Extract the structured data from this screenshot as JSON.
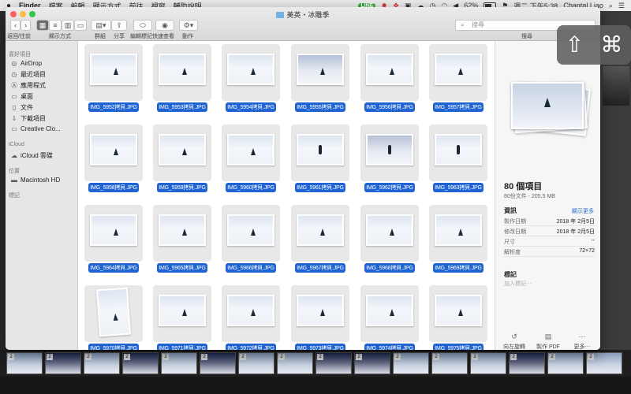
{
  "menubar": {
    "apple": "",
    "app_name": "Finder",
    "items": [
      "檔案",
      "編輯",
      "顯示方式",
      "前往",
      "視窗",
      "輔助說明"
    ],
    "status": {
      "line": "LINE",
      "battery": "62%",
      "datetime": "週二 下午5:38",
      "user": "Chantal Liao"
    }
  },
  "window": {
    "title": "美英・冰雕季",
    "toolbar": {
      "nav_label": "返回/往前",
      "view_label": "顯示方式",
      "group_label": "群組",
      "share_label": "分享",
      "tags_label": "編輯標記",
      "quicklook_label": "快速查看",
      "action_label": "動作",
      "search_placeholder": "搜尋",
      "search_label": "搜尋"
    }
  },
  "sidebar": {
    "favorites_header": "喜好項目",
    "favorites": [
      {
        "label": "AirDrop",
        "icon": "airdrop-icon"
      },
      {
        "label": "最近項目",
        "icon": "clock-icon"
      },
      {
        "label": "應用程式",
        "icon": "apps-icon"
      },
      {
        "label": "桌面",
        "icon": "desktop-icon"
      },
      {
        "label": "文件",
        "icon": "document-icon"
      },
      {
        "label": "下載項目",
        "icon": "download-icon"
      },
      {
        "label": "Creative Clo...",
        "icon": "folder-icon"
      }
    ],
    "icloud_header": "iCloud",
    "icloud": [
      {
        "label": "iCloud 雲碟",
        "icon": "cloud-icon"
      }
    ],
    "locations_header": "位置",
    "locations": [
      {
        "label": "Macintosh HD",
        "icon": "disk-icon"
      }
    ],
    "tags_header": "標記"
  },
  "files": [
    {
      "name": "IMG_5952拷貝.JPG",
      "subject": "tree"
    },
    {
      "name": "IMG_5953拷貝.JPG",
      "subject": "tree"
    },
    {
      "name": "IMG_5954拷貝.JPG",
      "subject": "tree"
    },
    {
      "name": "IMG_5955拷貝.JPG",
      "subject": "tree-dark"
    },
    {
      "name": "IMG_5956拷貝.JPG",
      "subject": "tree"
    },
    {
      "name": "IMG_5957拷貝.JPG",
      "subject": "tree"
    },
    {
      "name": "IMG_5958拷貝.JPG",
      "subject": "tree"
    },
    {
      "name": "IMG_5959拷貝.JPG",
      "subject": "tree"
    },
    {
      "name": "IMG_5960拷貝.JPG",
      "subject": "tree"
    },
    {
      "name": "IMG_5961拷貝.JPG",
      "subject": "person"
    },
    {
      "name": "IMG_5962拷貝.JPG",
      "subject": "person-dark"
    },
    {
      "name": "IMG_5963拷貝.JPG",
      "subject": "person"
    },
    {
      "name": "IMG_5964拷貝.JPG",
      "subject": "tree"
    },
    {
      "name": "IMG_5965拷貝.JPG",
      "subject": "tree"
    },
    {
      "name": "IMG_5966拷貝.JPG",
      "subject": "tree"
    },
    {
      "name": "IMG_5967拷貝.JPG",
      "subject": "tree"
    },
    {
      "name": "IMG_5968拷貝.JPG",
      "subject": "tree"
    },
    {
      "name": "IMG_5969拷貝.JPG",
      "subject": "tree"
    },
    {
      "name": "IMG_5970拷貝.JPG",
      "subject": "portrait"
    },
    {
      "name": "IMG_5971拷貝.JPG",
      "subject": "tree"
    },
    {
      "name": "IMG_5972拷貝.JPG",
      "subject": "tree"
    },
    {
      "name": "IMG_5973拷貝.JPG",
      "subject": "tree"
    },
    {
      "name": "IMG_5974拷貝.JPG",
      "subject": "tree"
    },
    {
      "name": "IMG_5975拷貝.JPG",
      "subject": "tree"
    }
  ],
  "preview": {
    "count": "80 個項目",
    "subtitle": "80份文件 - 205.5 MB",
    "info_header": "資訊",
    "show_more": "顯示更多",
    "info": [
      {
        "label": "製作日期",
        "value": "2018 年 2月5日"
      },
      {
        "label": "修改日期",
        "value": "2018 年 2月5日"
      },
      {
        "label": "尺寸",
        "value": "--"
      },
      {
        "label": "解析度",
        "value": "72×72"
      }
    ],
    "tags_header": "標記",
    "tags_placeholder": "加入標記⋯",
    "actions": [
      {
        "label": "向左旋轉",
        "icon": "rotate-left-icon"
      },
      {
        "label": "製作 PDF",
        "icon": "pdf-icon"
      },
      {
        "label": "更多⋯",
        "icon": "more-icon"
      }
    ]
  },
  "overlay": {
    "shift": "⇧",
    "cmd": "⌘"
  },
  "filmstrip": {
    "badge": "2"
  }
}
